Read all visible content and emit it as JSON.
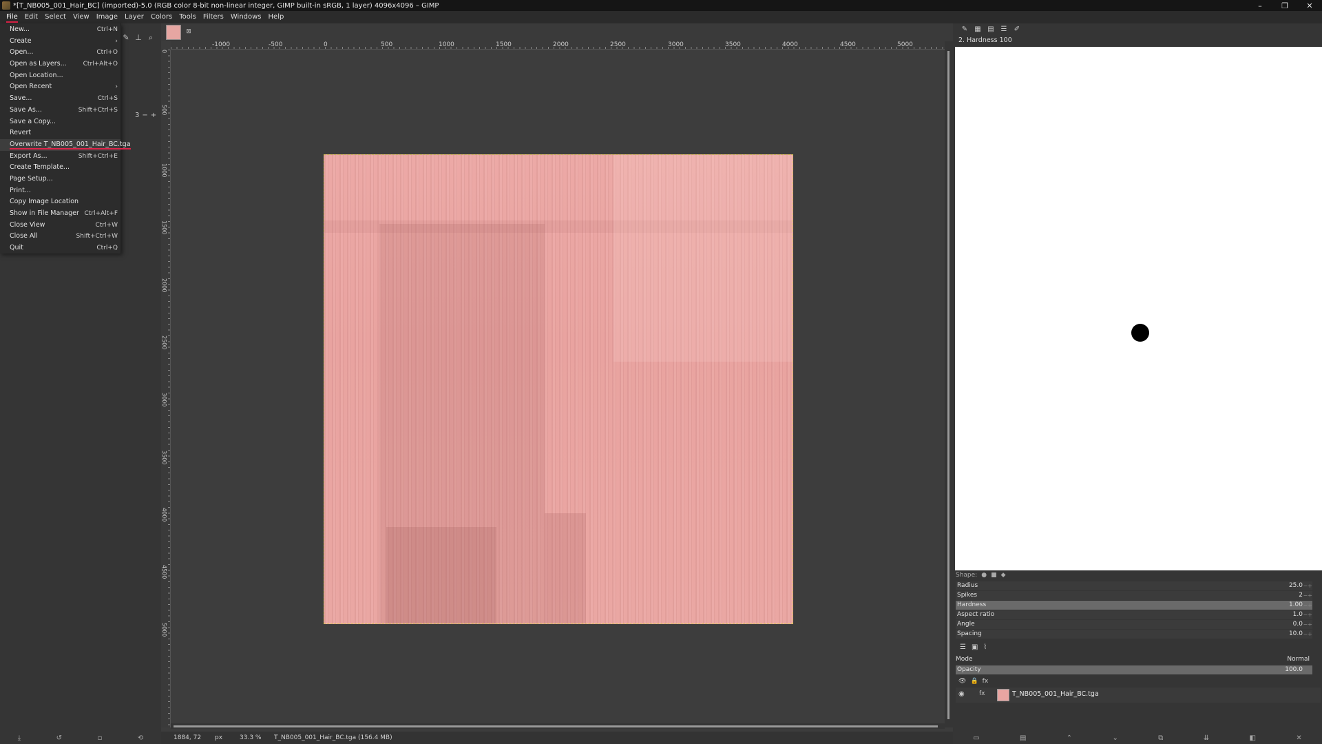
{
  "window": {
    "title": "*[T_NB005_001_Hair_BC] (imported)-5.0 (RGB color 8-bit non-linear integer, GIMP built-in sRGB, 1 layer) 4096x4096 – GIMP",
    "minimize": "–",
    "restore": "❐",
    "close": "✕"
  },
  "menubar": {
    "items": [
      "File",
      "Edit",
      "Select",
      "View",
      "Image",
      "Layer",
      "Colors",
      "Tools",
      "Filters",
      "Windows",
      "Help"
    ]
  },
  "file_menu": {
    "items": [
      {
        "label": "New...",
        "shortcut": "Ctrl+N"
      },
      {
        "label": "Create",
        "shortcut": "›"
      },
      {
        "label": "Open...",
        "shortcut": "Ctrl+O"
      },
      {
        "label": "Open as Layers...",
        "shortcut": "Ctrl+Alt+O"
      },
      {
        "label": "Open Location...",
        "shortcut": ""
      },
      {
        "label": "Open Recent",
        "shortcut": "›"
      },
      {
        "label": "Save...",
        "shortcut": "Ctrl+S"
      },
      {
        "label": "Save As...",
        "shortcut": "Shift+Ctrl+S"
      },
      {
        "label": "Save a Copy...",
        "shortcut": ""
      },
      {
        "label": "Revert",
        "shortcut": ""
      },
      {
        "label": "Overwrite T_NB005_001_Hair_BC.tga",
        "shortcut": ""
      },
      {
        "label": "Export As...",
        "shortcut": "Shift+Ctrl+E"
      },
      {
        "label": "Create Template...",
        "shortcut": ""
      },
      {
        "label": "Page Setup...",
        "shortcut": ""
      },
      {
        "label": "Print...",
        "shortcut": ""
      },
      {
        "label": "Copy Image Location",
        "shortcut": ""
      },
      {
        "label": "Show in File Manager",
        "shortcut": "Ctrl+Alt+F"
      },
      {
        "label": "Close View",
        "shortcut": "Ctrl+W"
      },
      {
        "label": "Close All",
        "shortcut": "Shift+Ctrl+W"
      },
      {
        "label": "Quit",
        "shortcut": "Ctrl+Q"
      }
    ]
  },
  "toolbox": {
    "spin_value": "3"
  },
  "ruler": {
    "h_labels": [
      "-1000",
      "-500",
      "0",
      "500",
      "1000",
      "1500",
      "2000",
      "2500",
      "3000",
      "3500",
      "4000",
      "4500",
      "5000"
    ],
    "v_labels": [
      "0",
      "500",
      "1000",
      "1500",
      "2000",
      "2500",
      "3000",
      "3500",
      "4000",
      "4500",
      "5000"
    ]
  },
  "statusbar": {
    "coords": "1884, 72",
    "unit": "px",
    "zoom": "33.3 %",
    "info": "T_NB005_001_Hair_BC.tga (156.4 MB)"
  },
  "brush": {
    "title": "2. Hardness 100",
    "shape_label": "Shape:",
    "params": [
      {
        "label": "Radius",
        "value": "25.0"
      },
      {
        "label": "Spikes",
        "value": "2"
      },
      {
        "label": "Hardness",
        "value": "1.00"
      },
      {
        "label": "Aspect ratio",
        "value": "1.0"
      },
      {
        "label": "Angle",
        "value": "0.0"
      },
      {
        "label": "Spacing",
        "value": "10.0"
      }
    ]
  },
  "layers": {
    "mode_label": "Mode",
    "mode_value": "Normal",
    "opacity_label": "Opacity",
    "opacity_value": "100.0",
    "layer_name": "T_NB005_001_Hair_BC.tga"
  }
}
